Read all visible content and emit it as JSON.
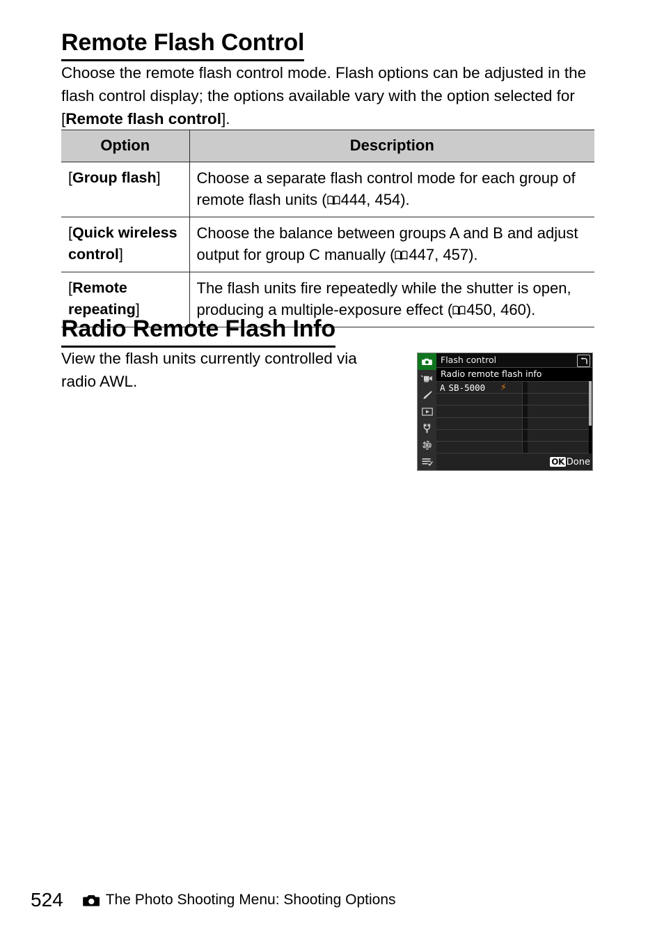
{
  "document": {
    "page_number": "524",
    "footer_text": "The Photo Shooting Menu: Shooting Options",
    "footer_icon": "camera-icon"
  },
  "sections": [
    {
      "heading": "Remote Flash Control",
      "intro_before": "Choose the remote flash control mode. Flash options can be adjusted in the flash control display; the options available vary with the option selected for [",
      "intro_bold": "Remote flash control",
      "intro_after": "]."
    },
    {
      "heading": "Radio Remote Flash Info",
      "paragraph": "View the flash units currently controlled via radio AWL."
    }
  ],
  "table": {
    "headers": {
      "option": "Option",
      "description": "Description"
    },
    "rows": [
      {
        "option_open": "[",
        "option_bold": "Group flash",
        "option_close": "]",
        "desc_before": "Choose a separate flash control mode for each group of remote flash units (",
        "ref_icon": "book-reference-icon",
        "desc_refs": "444, 454",
        "desc_after": ")."
      },
      {
        "option_open": "[",
        "option_bold": "Quick wireless control",
        "option_close": "]",
        "desc_before": "Choose the balance between groups A and B and adjust output for group C manually (",
        "ref_icon": "book-reference-icon",
        "desc_refs": "447, 457",
        "desc_after": ")."
      },
      {
        "option_open": "[",
        "option_bold": "Remote repeating",
        "option_close": "]",
        "desc_before": "The flash units fire repeatedly while the shutter is open, producing a multiple-exposure effect (",
        "ref_icon": "book-reference-icon",
        "desc_refs": "450, 460",
        "desc_after": ")."
      }
    ]
  },
  "camera_screen": {
    "title": "Flash control",
    "subtitle": "Radio remote flash info",
    "back_icon": "return-arrow-icon",
    "sidebar_icons": [
      {
        "name": "photo-shooting-menu-icon",
        "active": true
      },
      {
        "name": "movie-shooting-menu-icon",
        "active": false
      },
      {
        "name": "custom-settings-menu-icon",
        "active": false
      },
      {
        "name": "playback-menu-icon",
        "active": false
      },
      {
        "name": "setup-menu-icon",
        "active": false
      },
      {
        "name": "retouch-menu-icon",
        "active": false
      },
      {
        "name": "my-menu-icon",
        "active": false
      }
    ],
    "rows": [
      {
        "group": "A",
        "unit": "SB-5000",
        "status_icon": "flash-bolt-icon"
      },
      {
        "group": "",
        "unit": "",
        "status_icon": ""
      },
      {
        "group": "",
        "unit": "",
        "status_icon": ""
      },
      {
        "group": "",
        "unit": "",
        "status_icon": ""
      },
      {
        "group": "",
        "unit": "",
        "status_icon": ""
      },
      {
        "group": "",
        "unit": "",
        "status_icon": ""
      }
    ],
    "footer": {
      "ok_badge": "OK",
      "done_label": "Done"
    },
    "colors": {
      "active_tab": "#10751f",
      "bolt": "#e07810",
      "screen_bg": "#1b1b1b"
    }
  }
}
